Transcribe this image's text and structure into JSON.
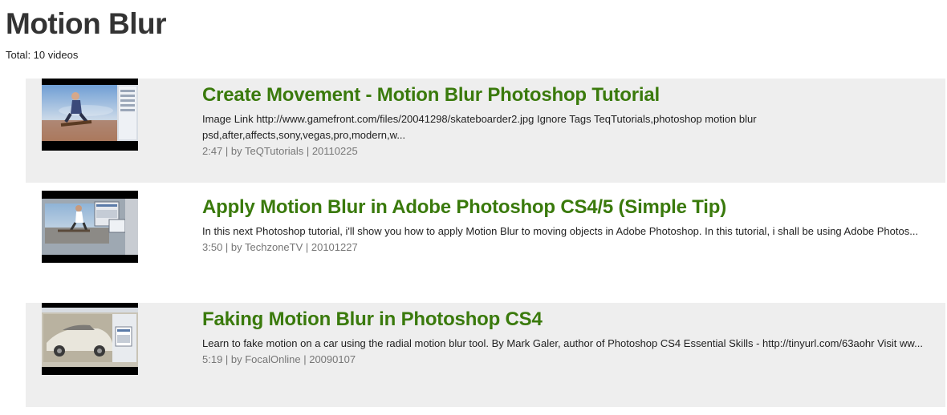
{
  "page": {
    "title": "Motion Blur",
    "total": "Total: 10 videos"
  },
  "videos": [
    {
      "title": "Create Movement - Motion Blur Photoshop Tutorial",
      "description": "Image Link http://www.gamefront.com/files/20041298/skateboarder2.jpg Ignore Tags TeqTutorials,photoshop motion blur psd,after,affects,sony,vegas,pro,modern,w...",
      "meta": "2:47 | by TeQTutorials | 20110225",
      "shaded": true
    },
    {
      "title": "Apply Motion Blur in Adobe Photoshop CS4/5 (Simple Tip)",
      "description": "In this next Photoshop tutorial, i'll show you how to apply Motion Blur to moving objects in Adobe Photoshop. In this tutorial, i shall be using Adobe Photos...",
      "meta": "3:50 | by TechzoneTV | 20101227",
      "shaded": false
    },
    {
      "title": "Faking Motion Blur in Photoshop CS4",
      "description": "Learn to fake motion on a car using the radial motion blur tool. By Mark Galer, author of Photoshop CS4 Essential Skills - http://tinyurl.com/63aohr Visit ww...",
      "meta": "5:19 | by FocalOnline | 20090107",
      "shaded": true
    }
  ],
  "colors": {
    "title_link": "#3a7a0c",
    "row_shade": "#eeeeee",
    "meta_text": "#777777"
  }
}
